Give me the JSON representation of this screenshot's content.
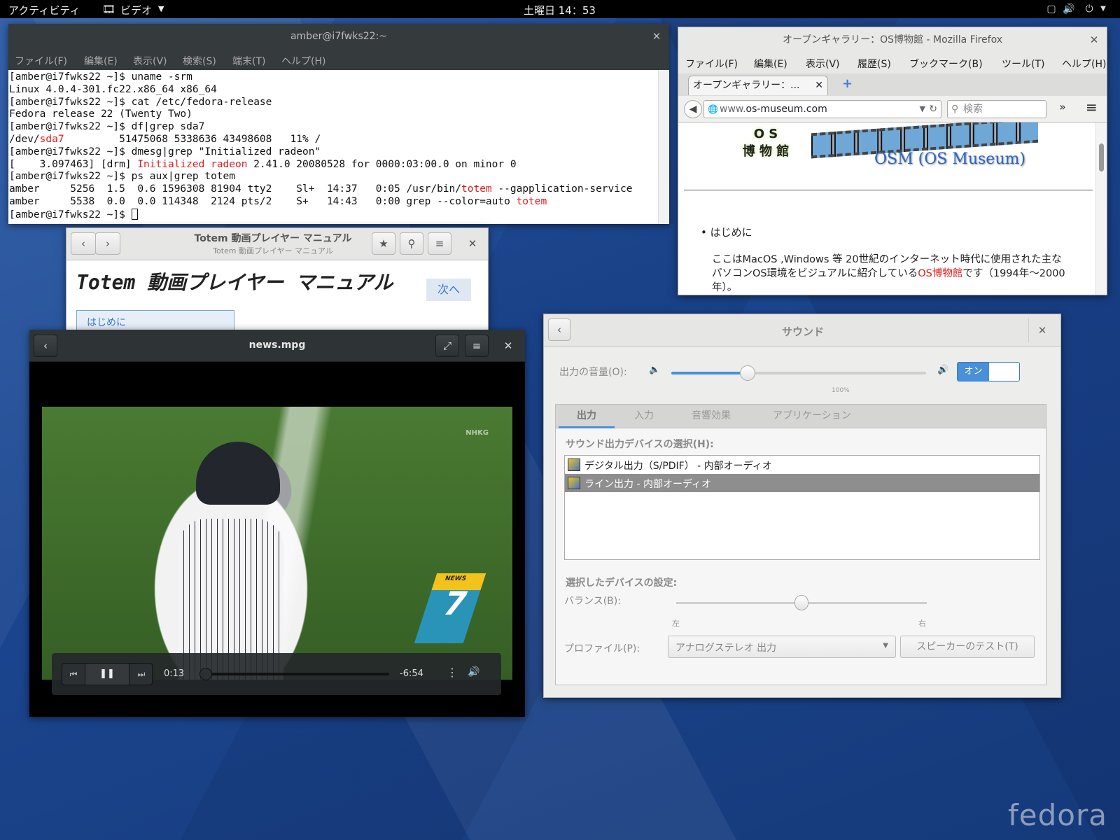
{
  "topbar": {
    "activities": "アクティビティ",
    "app_menu": "ビデオ",
    "clock": "土曜日 14：53"
  },
  "terminal": {
    "title": "amber@i7fwks22:~",
    "menu": [
      "ファイル(F)",
      "編集(E)",
      "表示(V)",
      "検索(S)",
      "端末(T)",
      "ヘルプ(H)"
    ],
    "lines": [
      [
        {
          "t": "[amber@i7fwks22 ~]$ uname -srm"
        }
      ],
      [
        {
          "t": "Linux 4.0.4-301.fc22.x86_64 x86_64"
        }
      ],
      [
        {
          "t": "[amber@i7fwks22 ~]$ cat /etc/fedora-release"
        }
      ],
      [
        {
          "t": "Fedora release 22 (Twenty Two)"
        }
      ],
      [
        {
          "t": "[amber@i7fwks22 ~]$ df|grep sda7"
        }
      ],
      [
        {
          "t": "/dev/"
        },
        {
          "t": "sda7",
          "c": "red"
        },
        {
          "t": "         51475068 5338636 43498608   11% /"
        }
      ],
      [
        {
          "t": "[amber@i7fwks22 ~]$ dmesg|grep \"Initialized radeon\""
        }
      ],
      [
        {
          "t": "[    3.097463] [drm] "
        },
        {
          "t": "Initialized radeon",
          "c": "red"
        },
        {
          "t": " 2.41.0 20080528 for 0000:03:00.0 on minor 0"
        }
      ],
      [
        {
          "t": "[amber@i7fwks22 ~]$ ps aux|grep totem"
        }
      ],
      [
        {
          "t": "amber     5256  1.5  0.6 1596308 81904 tty2    Sl+  14:37   0:05 /usr/bin/"
        },
        {
          "t": "totem",
          "c": "red"
        },
        {
          "t": " --gapplication-service"
        }
      ],
      [
        {
          "t": "amber     5538  0.0  0.0 114348  2124 pts/2    S+   14:43   0:00 grep --color=auto "
        },
        {
          "t": "totem",
          "c": "red"
        }
      ],
      [
        {
          "t": "[amber@i7fwks22 ~]$ "
        }
      ]
    ]
  },
  "firefox": {
    "title": "オープンギャラリー：OS博物館 - Mozilla Firefox",
    "menu": [
      "ファイル(F)",
      "編集(E)",
      "表示(V)",
      "履歴(S)",
      "ブックマーク(B)",
      "ツール(T)",
      "ヘルプ(H)"
    ],
    "tab": "オープンギャラリー：...",
    "url_prefix": "www.",
    "url_domain": "os-museum.com",
    "search_placeholder": "検索",
    "logo_top": "O S",
    "logo_bottom": "博 物 館",
    "banner": "OSM (OS Museum)",
    "bullet": "はじめに",
    "para_1": "ここはMacOS ,Windows 等 20世紀のインターネット時代に使用された主な",
    "para_2a": "パソコンOS環境をビジュアルに紹介している",
    "para_2link": "OS博物館",
    "para_2b": "です（1994年～2000",
    "para_3": "年）。"
  },
  "help": {
    "title": "Totem 動画プレイヤー マニュアル",
    "subtitle": "Totem 動画プレイヤー マニュアル",
    "heading": "Totem 動画プレイヤー マニュアル",
    "next": "次へ",
    "toc": "はじめに"
  },
  "totem": {
    "title": "news.mpg",
    "elapsed": "0:13",
    "remaining": "-6:54",
    "progress": 0.03,
    "watermark": "NHKG",
    "logo_num": "7",
    "logo_text": "NEWS"
  },
  "sound": {
    "title": "サウンド",
    "volume_label": "出力の音量(O):",
    "volume": 0.3,
    "mark_100": "100%",
    "toggle_on": "オン",
    "tabs": [
      "出力",
      "入力",
      "音響効果",
      "アプリケーション"
    ],
    "device_header": "サウンド出力デバイスの選択(H):",
    "devices": [
      "デジタル出力（S/PDIF） - 内部オーディオ",
      "ライン出力 - 内部オーディオ"
    ],
    "selected_device": 1,
    "settings_header": "選択したデバイスの設定:",
    "balance_label": "バランス(B):",
    "balance": 0.5,
    "left": "左",
    "right": "右",
    "profile_label": "プロファイル(P):",
    "profile_value": "アナログステレオ 出力",
    "test_button": "スピーカーのテスト(T)"
  },
  "wallpaper_logo": "fedora"
}
